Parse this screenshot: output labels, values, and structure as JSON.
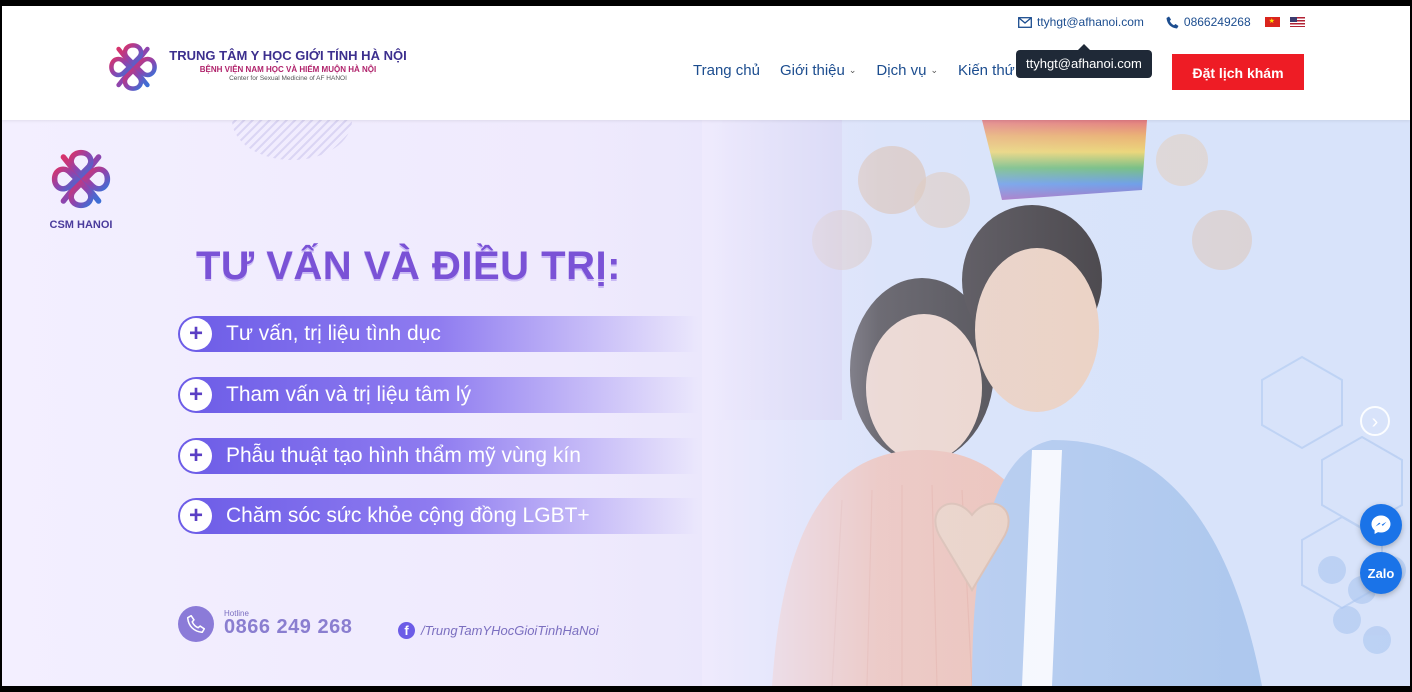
{
  "header": {
    "logo": {
      "line1": "TRUNG TÂM Y HỌC GIỚI TÍNH HÀ NỘI",
      "line2": "BỆNH VIỆN NAM HỌC VÀ HIẾM MUỘN HÀ NỘI",
      "line3": "Center for Sexual Medicine of AF HANOI"
    },
    "topbar": {
      "email": "ttyhgt@afhanoi.com",
      "phone": "0866249268",
      "languages": [
        "vi-flag-icon",
        "en-flag-icon"
      ]
    },
    "tooltip": "ttyhgt@afhanoi.com",
    "nav": [
      {
        "label": "Trang chủ",
        "has_dropdown": false
      },
      {
        "label": "Giới thiệu",
        "has_dropdown": true
      },
      {
        "label": "Dịch vụ",
        "has_dropdown": true
      },
      {
        "label": "Kiến thứ",
        "has_dropdown": false
      }
    ],
    "book_button": "Đặt lịch khám",
    "colors": {
      "brand": "#3c2f8e",
      "accent": "#ee1c25",
      "link": "#1c4d8f"
    }
  },
  "hero": {
    "badge": "CSM HANOI",
    "title": "TƯ VẤN VÀ ĐIỀU TRỊ:",
    "services": [
      "Tư vấn, trị liệu tình dục",
      "Tham vấn và trị liệu tâm lý",
      "Phẫu thuật tạo hình thẩm mỹ vùng kín",
      "Chăm sóc sức khỏe cộng đồng LGBT+"
    ],
    "hotline_label": "Hotline",
    "hotline_number": "0866 249 268",
    "facebook": "/TrungTamYHocGioiTinhHaNoi"
  },
  "floating": {
    "zalo": "Zalo"
  }
}
